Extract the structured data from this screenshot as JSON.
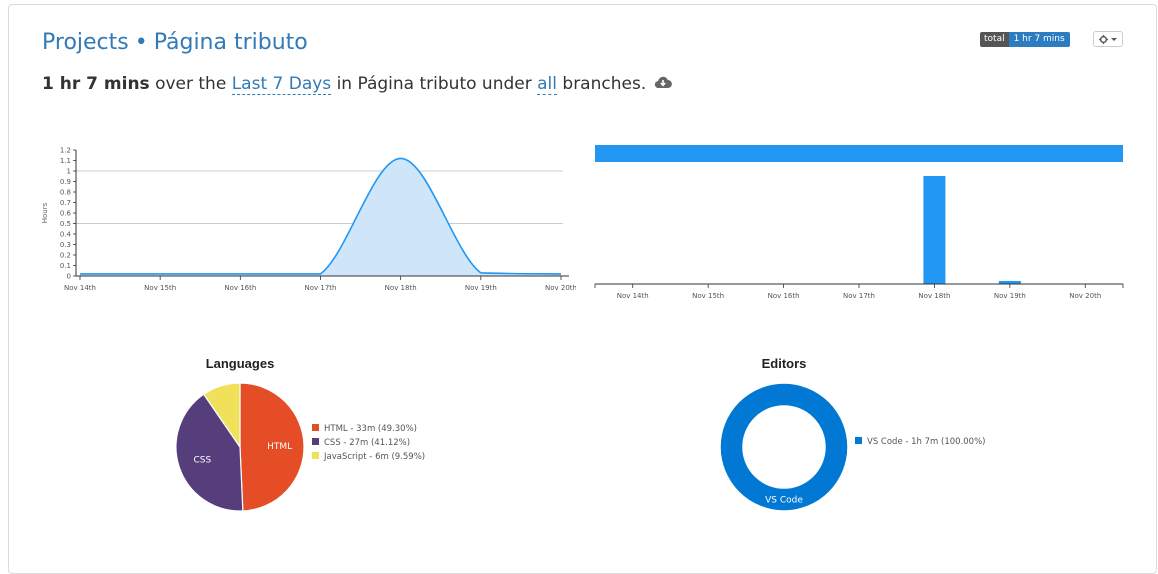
{
  "breadcrumb": {
    "projects": "Projects",
    "separator": "•",
    "project": "Página tributo"
  },
  "summary": {
    "total": "1 hr 7 mins",
    "over_the": "over the",
    "range": "Last 7 Days",
    "in": "in",
    "project": "Página tributo",
    "under": "under",
    "branches_link": "all",
    "branches": "branches."
  },
  "badge": {
    "label": "total",
    "value": "1 hr 7 mins",
    "label_color": "#555555",
    "value_color": "#2b7cc0"
  },
  "settings_button": {
    "icon": "gear-icon",
    "caret": "chevron-down-icon"
  },
  "chart_data": [
    {
      "type": "area",
      "ylabel": "Hours",
      "xlabel": "",
      "ylim": [
        0,
        1.2
      ],
      "yticks": [
        "0",
        "0.1",
        "0.2",
        "0.3",
        "0.4",
        "0.5",
        "0.6",
        "0.7",
        "0.8",
        "0.9",
        "1",
        "1.1",
        "1.2"
      ],
      "grid": true,
      "categories": [
        "Nov 14th",
        "Nov 15th",
        "Nov 16th",
        "Nov 17th",
        "Nov 18th",
        "Nov 19th",
        "Nov 20th"
      ],
      "series": [
        {
          "values": [
            0,
            0,
            0,
            0,
            1.12,
            0.03,
            0
          ],
          "color": "#2196f3",
          "fill": "#cfe6fa"
        }
      ]
    },
    {
      "type": "bar",
      "categories": [
        "Nov 14th",
        "Nov 15th",
        "Nov 16th",
        "Nov 17th",
        "Nov 18th",
        "Nov 19th",
        "Nov 20th"
      ],
      "series": [
        {
          "values": [
            0,
            0,
            0,
            0,
            1.08,
            0.03,
            0
          ],
          "color": "#2196f3"
        }
      ],
      "top_band_color": "#2196f3"
    },
    {
      "type": "pie",
      "title": "Languages",
      "slices": [
        {
          "name": "HTML",
          "legend": "HTML - 33m (49.30%)",
          "value": 49.3,
          "color": "#e44d26"
        },
        {
          "name": "CSS",
          "legend": "CSS - 27m (41.12%)",
          "value": 41.12,
          "color": "#563d7c"
        },
        {
          "name": "JavaScript",
          "legend": "JavaScript - 6m (9.59%)",
          "value": 9.59,
          "color": "#f1e05a"
        }
      ],
      "legend_placement": "right"
    },
    {
      "type": "pie",
      "title": "Editors",
      "slices": [
        {
          "name": "VS Code",
          "legend": "VS Code - 1h 7m (100.00%)",
          "value": 100.0,
          "color": "#0078d4"
        }
      ],
      "legend_placement": "right"
    }
  ]
}
